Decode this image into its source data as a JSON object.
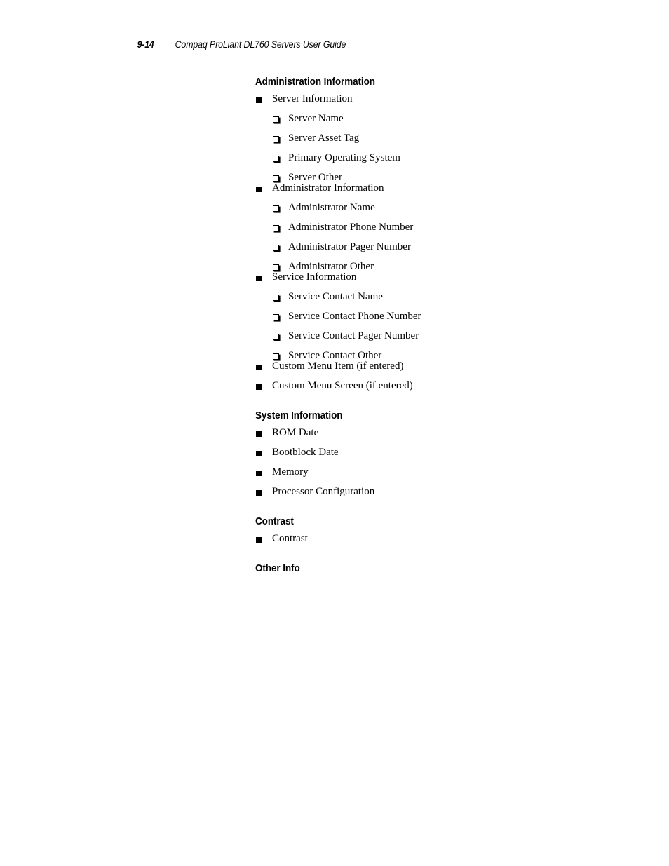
{
  "header": {
    "page_number": "9-14",
    "document_title": "Compaq ProLiant DL760 Servers User Guide"
  },
  "bullets": {
    "level1": "solid-square",
    "level2": "hollow-square"
  },
  "sections": [
    {
      "heading": "Administration Information",
      "items": [
        {
          "label": "Server Information",
          "children": [
            {
              "label": "Server Name"
            },
            {
              "label": "Server Asset Tag"
            },
            {
              "label": "Primary Operating System"
            },
            {
              "label": "Server Other"
            }
          ]
        },
        {
          "label": "Administrator Information",
          "children": [
            {
              "label": "Administrator Name"
            },
            {
              "label": "Administrator Phone Number"
            },
            {
              "label": "Administrator Pager Number"
            },
            {
              "label": "Administrator Other"
            }
          ]
        },
        {
          "label": "Service Information",
          "children": [
            {
              "label": "Service Contact Name"
            },
            {
              "label": "Service Contact Phone Number"
            },
            {
              "label": "Service Contact Pager Number"
            },
            {
              "label": "Service Contact Other"
            }
          ]
        },
        {
          "label": "Custom Menu Item (if entered)",
          "children": []
        },
        {
          "label": "Custom Menu Screen (if entered)",
          "children": []
        }
      ]
    },
    {
      "heading": "System Information",
      "items": [
        {
          "label": "ROM Date",
          "children": []
        },
        {
          "label": "Bootblock Date",
          "children": []
        },
        {
          "label": "Memory",
          "children": []
        },
        {
          "label": "Processor Configuration",
          "children": []
        }
      ]
    },
    {
      "heading": "Contrast",
      "items": [
        {
          "label": "Contrast",
          "children": []
        }
      ]
    },
    {
      "heading": "Other Info",
      "items": []
    }
  ]
}
